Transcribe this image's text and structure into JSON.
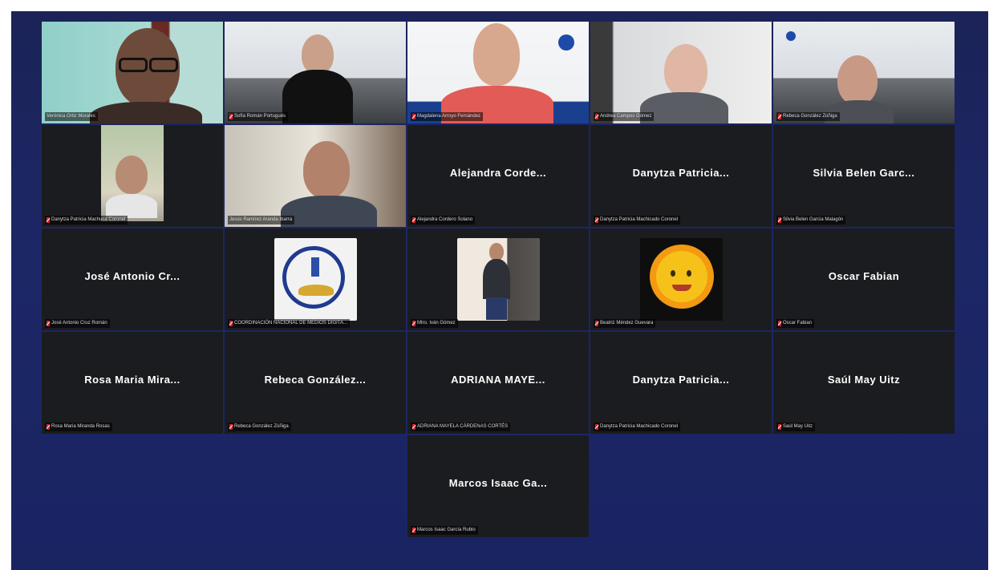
{
  "participants": [
    {
      "display_name": "",
      "name_tag": "Verónica Ortiz Morales",
      "video": true
    },
    {
      "display_name": "",
      "name_tag": "Sofía Román Portugués",
      "video": true
    },
    {
      "display_name": "",
      "name_tag": "Magdalena Arroyo Fernández",
      "video": true
    },
    {
      "display_name": "",
      "name_tag": "Andrea Campos Gómez",
      "video": true
    },
    {
      "display_name": "",
      "name_tag": "Rebeca González Zúñiga",
      "video": true
    },
    {
      "display_name": "",
      "name_tag": "Danytza Patricia Machuca Coronel",
      "video": true
    },
    {
      "display_name": "",
      "name_tag": "Jesús Ramírez Aranda Ibarra",
      "video": true
    },
    {
      "display_name": "Alejandra Corde...",
      "name_tag": "Alejandra Cordero Solano",
      "video": false
    },
    {
      "display_name": "Danytza Patricia...",
      "name_tag": "Danytza Patricia Machicado Coronel",
      "video": false
    },
    {
      "display_name": "Silvia Belen Garc...",
      "name_tag": "Silvia Belen Garcia Malagón",
      "video": false
    },
    {
      "display_name": "José Antonio Cr...",
      "name_tag": "José Antonio Cruz Román",
      "video": false
    },
    {
      "display_name": "",
      "name_tag": "COORDINACIÓN NACIONAL DE MEDIOS DIGITA...",
      "video": true
    },
    {
      "display_name": "",
      "name_tag": "Mtro. Iván Gómez",
      "video": true
    },
    {
      "display_name": "",
      "name_tag": "Beatriz Méndez Guevara",
      "video": true
    },
    {
      "display_name": "Oscar Fabian",
      "name_tag": "Oscar Fabian",
      "video": false
    },
    {
      "display_name": "Rosa Maria Mira...",
      "name_tag": "Rosa Maria Miranda Rosas",
      "video": false
    },
    {
      "display_name": "Rebeca González...",
      "name_tag": "Rebeca González Zúñiga",
      "video": false
    },
    {
      "display_name": "ADRIANA MAYE...",
      "name_tag": "ADRIANA MAYELA CÁRDENAS CORTÉS",
      "video": false
    },
    {
      "display_name": "Danytza Patricia...",
      "name_tag": "Danytza Patricia Machicado Coronel",
      "video": false
    },
    {
      "display_name": "Saúl May Uitz",
      "name_tag": "Saúl May Uitz",
      "video": false
    },
    {
      "display_name": "Marcos Isaac Ga...",
      "name_tag": "Marcos Isaac García Rubio",
      "video": false
    }
  ],
  "colors": {
    "background": "#1c2766",
    "tile": "#1b1c1f",
    "active_speaker": "#2fc77a",
    "muted_mic": "#e0242a"
  },
  "icons": {
    "muted": "mic-muted-icon"
  }
}
